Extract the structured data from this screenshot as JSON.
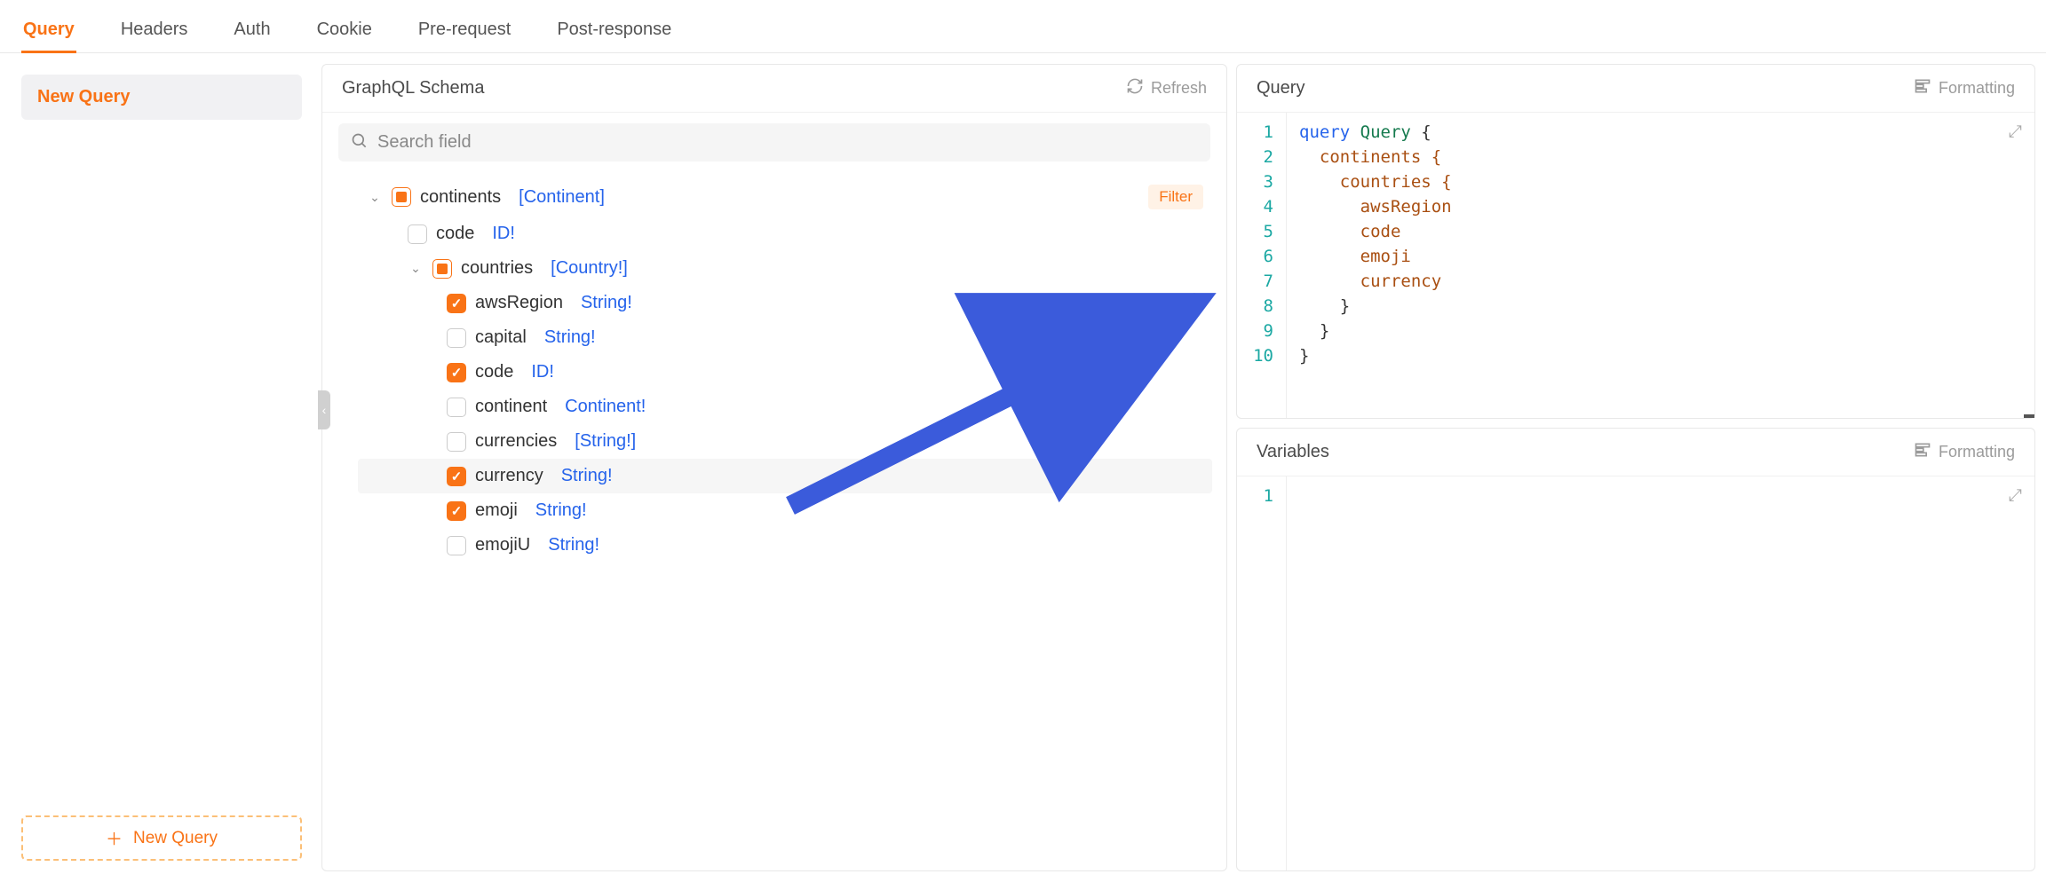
{
  "tabs": [
    "Query",
    "Headers",
    "Auth",
    "Cookie",
    "Pre-request",
    "Post-response"
  ],
  "activeTab": 0,
  "sidebar": {
    "current": "New Query",
    "newButton": "New Query"
  },
  "schema": {
    "title": "GraphQL Schema",
    "refresh": "Refresh",
    "searchPlaceholder": "Search field",
    "filterLabel": "Filter",
    "tree": [
      {
        "name": "continents",
        "type": "[Continent]",
        "state": "partial",
        "expanded": true,
        "hasFilter": true,
        "children": [
          {
            "name": "code",
            "type": "ID!",
            "state": "unchecked"
          },
          {
            "name": "countries",
            "type": "[Country!]",
            "state": "partial",
            "expanded": true,
            "children": [
              {
                "name": "awsRegion",
                "type": "String!",
                "state": "checked"
              },
              {
                "name": "capital",
                "type": "String!",
                "state": "unchecked"
              },
              {
                "name": "code",
                "type": "ID!",
                "state": "checked"
              },
              {
                "name": "continent",
                "type": "Continent!",
                "state": "unchecked"
              },
              {
                "name": "currencies",
                "type": "[String!]",
                "state": "unchecked"
              },
              {
                "name": "currency",
                "type": "String!",
                "state": "checked",
                "hover": true
              },
              {
                "name": "emoji",
                "type": "String!",
                "state": "checked"
              },
              {
                "name": "emojiU",
                "type": "String!",
                "state": "unchecked"
              }
            ]
          }
        ]
      }
    ]
  },
  "queryPanel": {
    "title": "Query",
    "formatting": "Formatting",
    "lines": [
      [
        {
          "t": "query ",
          "c": "kw"
        },
        {
          "t": "Query",
          "c": "typ"
        },
        {
          "t": " {",
          "c": "brace"
        }
      ],
      [
        {
          "t": "  continents {",
          "c": "fld"
        }
      ],
      [
        {
          "t": "    countries {",
          "c": "fld"
        }
      ],
      [
        {
          "t": "      awsRegion",
          "c": "leaf"
        }
      ],
      [
        {
          "t": "      code",
          "c": "leaf"
        }
      ],
      [
        {
          "t": "      emoji",
          "c": "leaf"
        }
      ],
      [
        {
          "t": "      currency",
          "c": "leaf"
        }
      ],
      [
        {
          "t": "    }",
          "c": "brace"
        }
      ],
      [
        {
          "t": "  }",
          "c": "brace"
        }
      ],
      [
        {
          "t": "}",
          "c": "brace"
        }
      ]
    ]
  },
  "variablesPanel": {
    "title": "Variables",
    "formatting": "Formatting",
    "lineCount": 1
  }
}
